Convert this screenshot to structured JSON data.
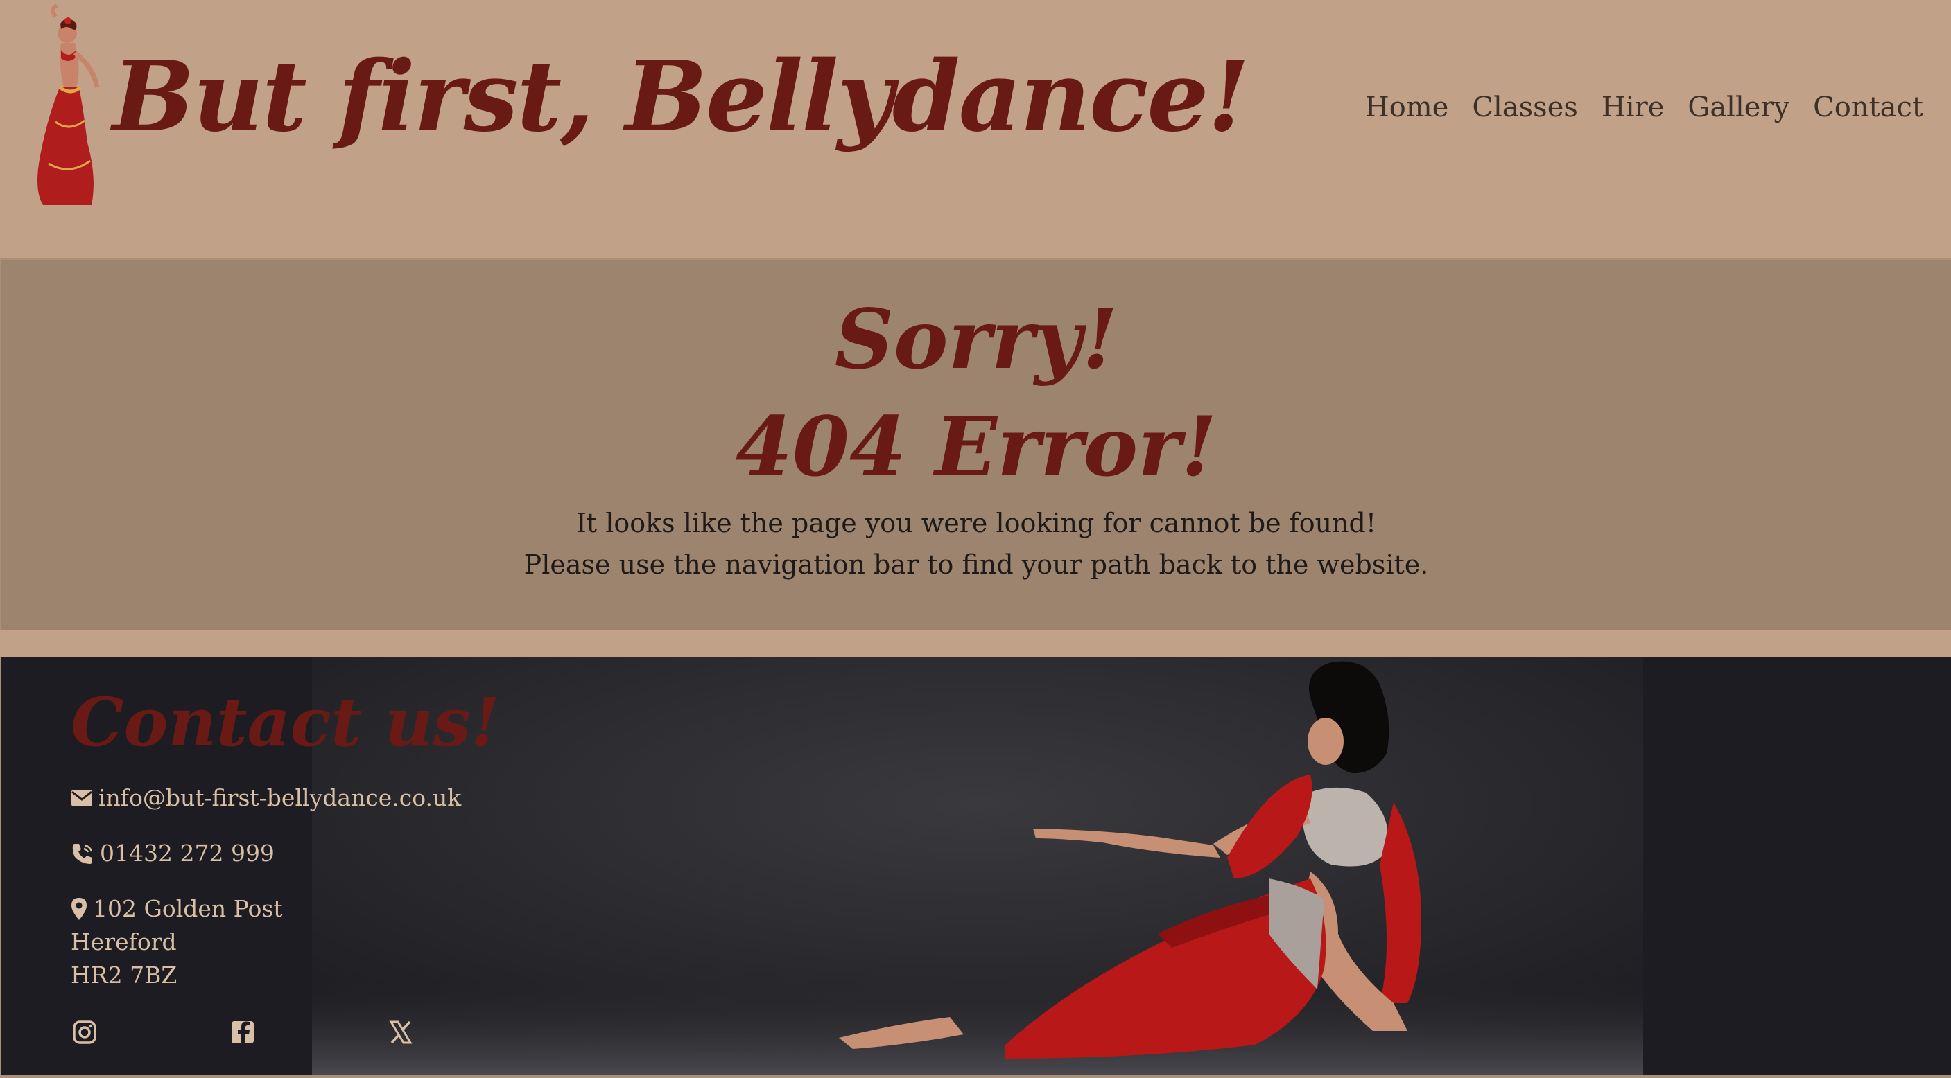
{
  "header": {
    "title": "But first, Bellydance!",
    "nav": [
      {
        "label": "Home"
      },
      {
        "label": "Classes"
      },
      {
        "label": "Hire"
      },
      {
        "label": "Gallery"
      },
      {
        "label": "Contact"
      }
    ]
  },
  "error": {
    "heading": "Sorry!",
    "code": "404 Error!",
    "line1": "It looks like the page you were looking for cannot be found!",
    "line2": "Please use the navigation bar to find your path back to the website."
  },
  "footer": {
    "heading": "Contact us!",
    "email": "info@but-first-bellydance.co.uk",
    "phone": "01432 272 999",
    "address": [
      "102 Golden Post",
      "Hereford",
      "HR2 7BZ"
    ],
    "social": [
      {
        "icon": "instagram-icon"
      },
      {
        "icon": "facebook-icon"
      },
      {
        "icon": "x-icon"
      }
    ]
  },
  "colors": {
    "header_bg": "#c1a187",
    "error_bg": "#9c846f",
    "footer_bg": "#1d1c22",
    "title": "#6a1a14",
    "footer_text": "#d8bfa5"
  }
}
